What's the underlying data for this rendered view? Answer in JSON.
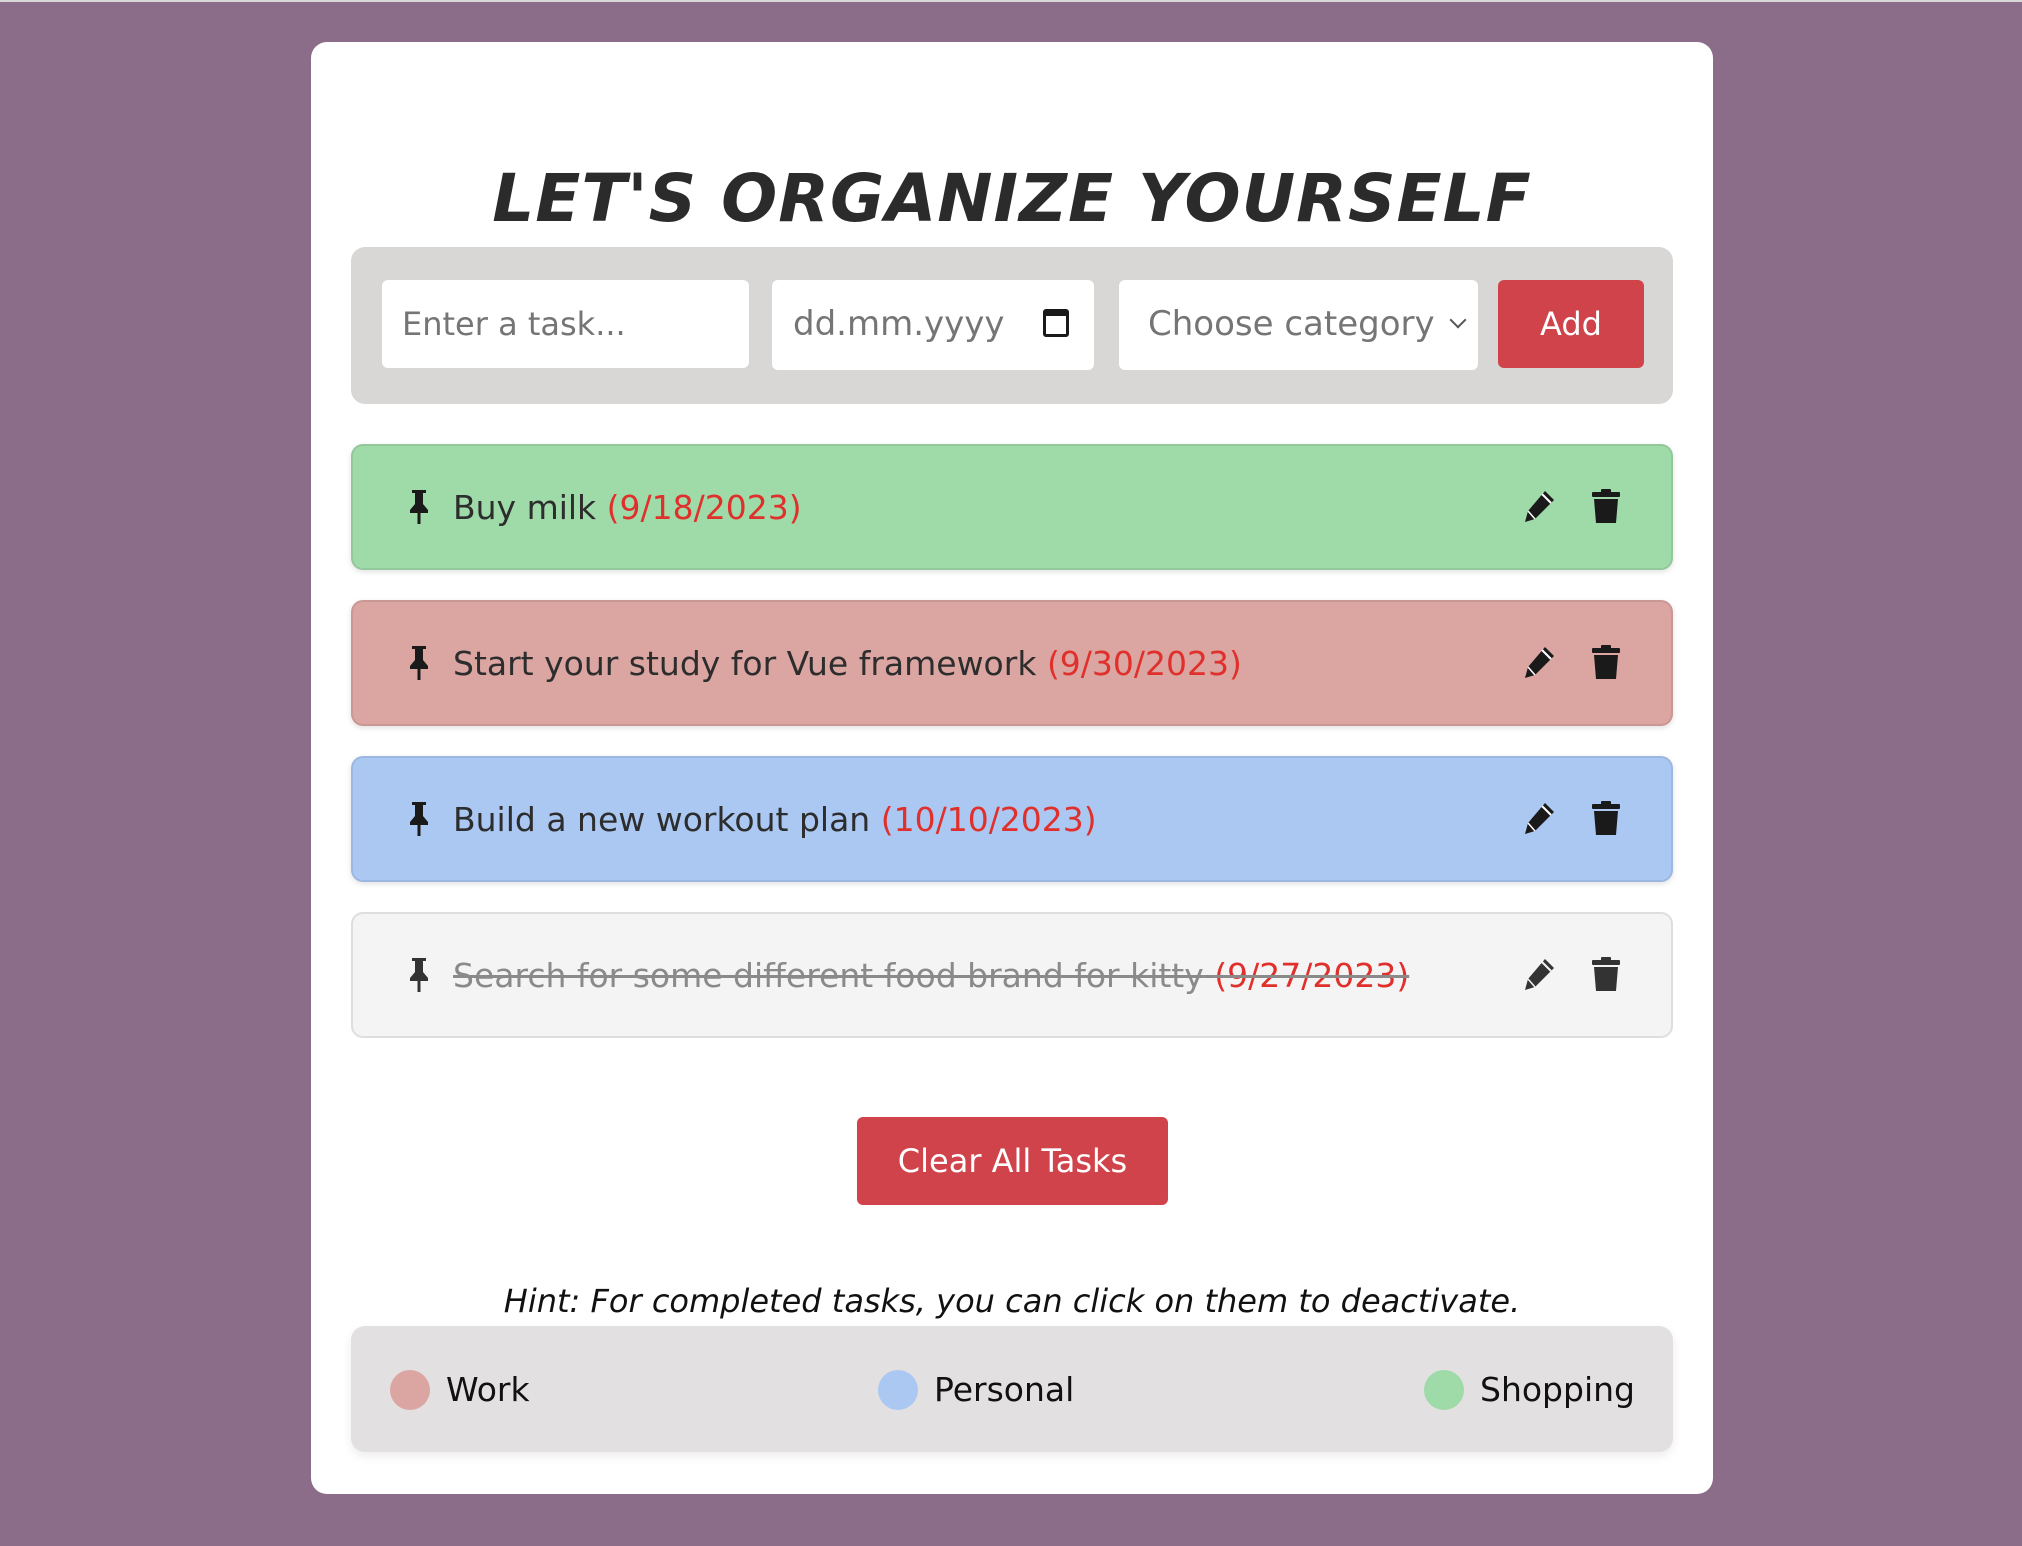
{
  "app": {
    "title": "LET'S ORGANIZE YOURSELF"
  },
  "form": {
    "task_placeholder": "Enter a task...",
    "date_placeholder": "dd.mm.yyyy",
    "category_selected": "Choose category",
    "add_label": "Add"
  },
  "tasks": [
    {
      "text": "Buy milk",
      "due": "(9/18/2023)",
      "category": "Shopping",
      "color": "#9fdaa9",
      "completed": false
    },
    {
      "text": "Start your study for Vue framework",
      "due": "(9/30/2023)",
      "category": "Work",
      "color": "#dba5a2",
      "completed": false
    },
    {
      "text": "Build a new workout plan",
      "due": "(10/10/2023)",
      "category": "Personal",
      "color": "#abc8f3",
      "completed": false
    },
    {
      "text": "Search for some different food brand for kitty",
      "due": "(9/27/2023)",
      "category": "",
      "color": "#f4f4f4",
      "completed": true
    }
  ],
  "actions": {
    "clear_label": "Clear All Tasks"
  },
  "hint": "Hint: For completed tasks, you can click on them to deactivate.",
  "legend": [
    {
      "label": "Work",
      "color": "#dba5a2"
    },
    {
      "label": "Personal",
      "color": "#abc8f3"
    },
    {
      "label": "Shopping",
      "color": "#9fdaa9"
    }
  ],
  "icons": {
    "pin": "pushpin-icon",
    "edit": "pencil-icon",
    "delete": "trash-icon",
    "date": "calendar-icon",
    "select": "chevron-down-icon"
  },
  "colors": {
    "background": "#8b6c89",
    "accent": "#d0434b",
    "date_text": "#e0302c"
  }
}
